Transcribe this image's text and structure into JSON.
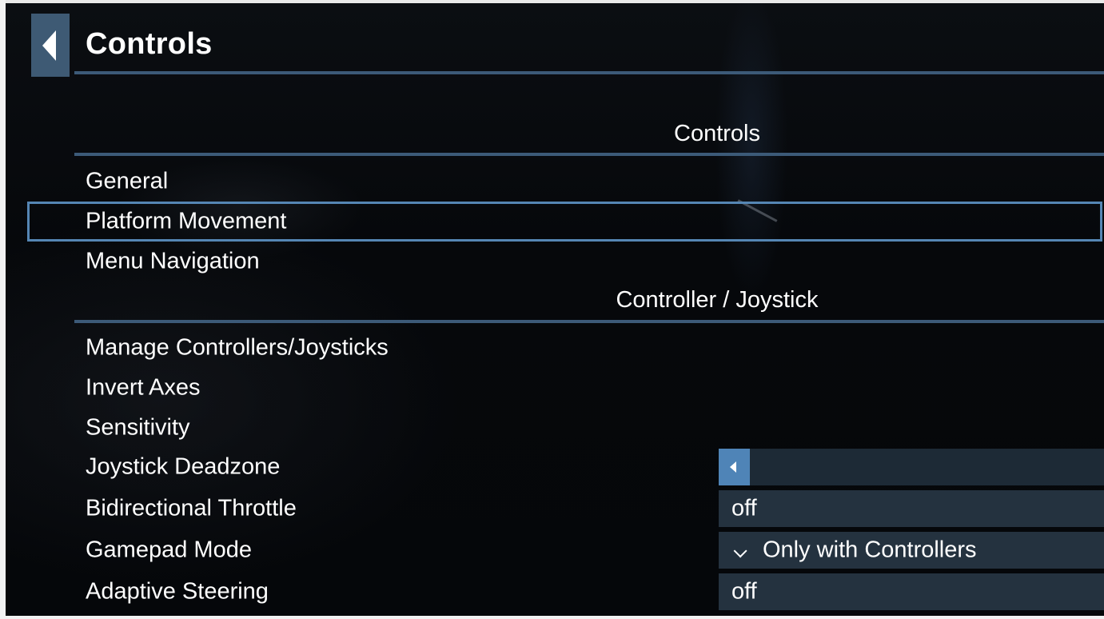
{
  "header": {
    "title": "Controls"
  },
  "sections": [
    {
      "title": "Controls",
      "items": [
        {
          "label": "General"
        },
        {
          "label": "Platform Movement"
        },
        {
          "label": "Menu Navigation"
        }
      ]
    },
    {
      "title": "Controller / Joystick",
      "items": [
        {
          "label": "Manage Controllers/Joysticks"
        },
        {
          "label": "Invert Axes"
        },
        {
          "label": "Sensitivity"
        },
        {
          "label": "Joystick Deadzone"
        },
        {
          "label": "Bidirectional Throttle",
          "value": "off"
        },
        {
          "label": "Gamepad Mode",
          "value": "Only with Controllers"
        },
        {
          "label": "Adaptive Steering",
          "value": "off"
        }
      ]
    }
  ],
  "selected_item": "Platform Movement",
  "colors": {
    "accent": "#3c5a78",
    "selection": "#5586b4",
    "slider_button": "#4f84b7",
    "control_bg": "#24323f",
    "back_button": "#3e5a74"
  },
  "icons": {
    "back": "back-arrow-icon",
    "slider_decrease": "slider-left-arrow-icon",
    "dropdown": "chevron-down-icon"
  }
}
